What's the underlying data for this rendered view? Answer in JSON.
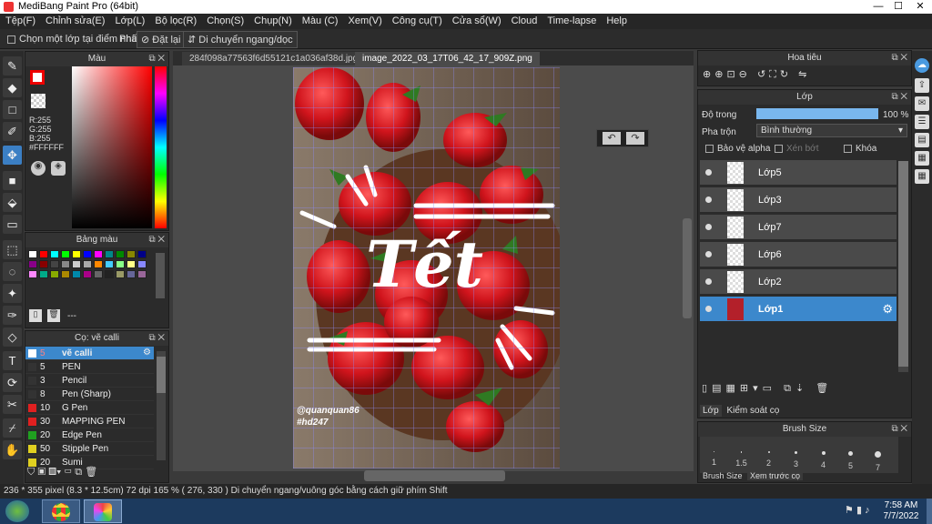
{
  "window": {
    "title": "MediBang Paint Pro (64bit)",
    "minimize": "—",
    "maximize": "☐",
    "close": "✕"
  },
  "menu": [
    "Tệp(F)",
    "Chỉnh sửa(E)",
    "Lớp(L)",
    "Bộ lọc(R)",
    "Chọn(S)",
    "Chụp(N)",
    "Màu (C)",
    "Xem(V)",
    "Công cụ(T)",
    "Cửa sổ(W)",
    "Cloud",
    "Time-lapse",
    "Help"
  ],
  "options": {
    "select_layer_label": "Chọn một lớp tại điểm nhấp",
    "key_label": "Phím",
    "reset_label": "Đặt lại",
    "move_label": "Di chuyển ngang/dọc"
  },
  "color_panel": {
    "title": "Màu",
    "r": "R:255",
    "g": "G:255",
    "b": "B:255",
    "hex": "#FFFFFF"
  },
  "palette_panel": {
    "title": "Bảng màu",
    "footer": "---"
  },
  "brush_panel": {
    "title": "Cọ: vẽ calli",
    "items": [
      {
        "num": "5",
        "label": "vẽ calli",
        "color": "#ffffff",
        "selected": true
      },
      {
        "num": "5",
        "label": "PEN",
        "color": "#333333"
      },
      {
        "num": "3",
        "label": "Pencil",
        "color": "#333333"
      },
      {
        "num": "8",
        "label": "Pen (Sharp)",
        "color": "#333333"
      },
      {
        "num": "10",
        "label": "G Pen",
        "color": "#e02020"
      },
      {
        "num": "30",
        "label": "MAPPING PEN",
        "color": "#e02020"
      },
      {
        "num": "20",
        "label": "Edge Pen",
        "color": "#20a020"
      },
      {
        "num": "50",
        "label": "Stipple Pen",
        "color": "#e0d020"
      },
      {
        "num": "20",
        "label": "Sumi",
        "color": "#e0d020"
      }
    ]
  },
  "tabs": [
    "284f098a77563f6d55121c1a036af38d.jpg",
    "image_2022_03_17T06_42_17_909Z.png"
  ],
  "canvas": {
    "watermark1": "@quanquan86",
    "watermark2": "#hd247",
    "art_text": "Tết"
  },
  "navigator": {
    "title": "Hoa tiêu"
  },
  "layer_panel": {
    "title": "Lớp",
    "opacity_label": "Độ trong",
    "opacity_value": "100 %",
    "opacity_fraction": 1.0,
    "blend_label": "Pha trộn",
    "blend_value": "Bình thường",
    "protect_alpha": "Bảo vệ alpha",
    "clipping": "Xén bớt",
    "lock": "Khóa",
    "layers": [
      "Lớp5",
      "Lớp3",
      "Lớp7",
      "Lớp6",
      "Lớp2",
      "Lớp1"
    ],
    "tab_layer": "Lớp",
    "tab_brush_check": "Kiểm soát cọ"
  },
  "brush_size_panel": {
    "title": "Brush Size",
    "sizes": [
      "1",
      "1.5",
      "2",
      "3",
      "4",
      "5",
      "7"
    ],
    "tab1": "Brush Size",
    "tab2": "Xem trước cọ"
  },
  "status": "236 * 355 pixel   (8.3 * 12.5cm)   72 dpi   165 %   ( 276, 330 )   Di chuyển ngang/vuông góc bằng cách giữ phím Shift",
  "taskbar": {
    "time": "7:58 AM",
    "date": "7/7/2022"
  }
}
